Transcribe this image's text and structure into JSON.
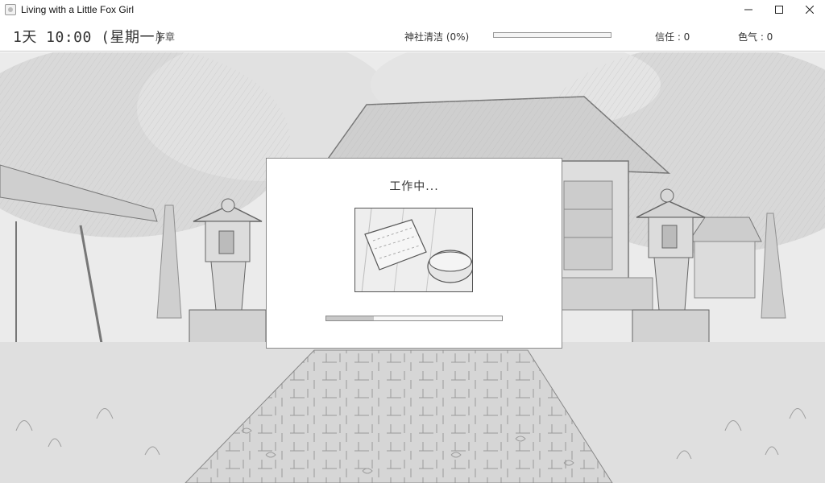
{
  "window": {
    "title": "Living with a Little Fox Girl",
    "controls": [
      "minimize-icon",
      "maximize-icon",
      "close-icon"
    ]
  },
  "status": {
    "date": "1天 10:00 (星期一)",
    "chapter": "序章",
    "shrine_clean_label": "神社清洁 (0%)",
    "shrine_clean_progress": 0,
    "trust_label": "信任 : 0",
    "lust_label": "色气 : 0"
  },
  "dialog": {
    "title": "工作中...",
    "image_icon": "cleaning-rag-and-bucket",
    "progress_fraction": 0.27
  },
  "colors": {
    "background": "#ffffff",
    "scene_tone": "#e9e9e9",
    "bar_border": "#8a8a8a",
    "bar_fill": "#c8c8c8"
  }
}
